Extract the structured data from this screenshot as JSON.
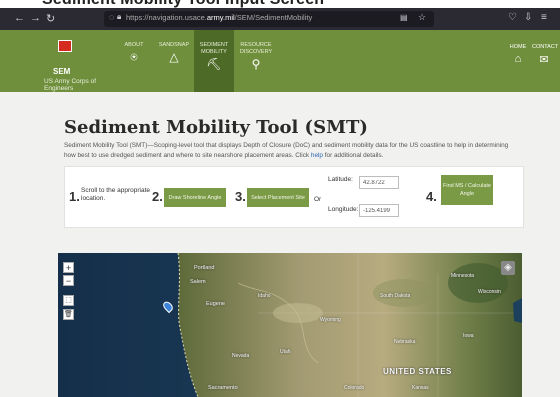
{
  "caption": "Sediment Mobility Tool Input Screen",
  "browser": {
    "url_prefix": "https://navigation.usace.",
    "url_domain": "army.mil",
    "url_path": "/SEM/SedimentMobility"
  },
  "logo": {
    "abbr": "SEM",
    "subtitle": "US Army Corps of Engineers"
  },
  "menu": [
    {
      "label": "ABOUT",
      "icon": "lightbulb-icon"
    },
    {
      "label": "SANDSNAP",
      "icon": "triangle-icon"
    },
    {
      "label": "SEDIMENT MOBILITY",
      "icon": "crane-icon",
      "active": true
    },
    {
      "label": "RESOURCE DISCOVERY",
      "icon": "search-icon"
    }
  ],
  "menu_right": [
    {
      "label": "HOME",
      "icon": "home-icon"
    },
    {
      "label": "CONTACT",
      "icon": "mail-icon"
    }
  ],
  "page": {
    "title": "Sediment Mobility Tool (SMT)",
    "description_pre": "Sediment Mobility Tool (SMT)—Scoping-level tool that displays Depth of Closure (DoC) and sediment mobility data for the US coastline to help in determining how best to use dredged sediment and where to site nearshore placement areas. Click ",
    "description_link": "help",
    "description_post": " for additional details."
  },
  "steps": {
    "step1_num": "1.",
    "step1_text": "Scroll to the appropriate location.",
    "step2_num": "2.",
    "step2_button": "Draw Shoreline Angle",
    "step3_num": "3.",
    "step3_button": "Select Placement Site",
    "or_text": "Or",
    "latitude_label": "Latitude:",
    "latitude_value": "42.8722",
    "longitude_label": "Longitude:",
    "longitude_value": "-125.4199",
    "step4_num": "4.",
    "step4_button": "Find MS / Calculate Angle"
  },
  "map": {
    "zoom_in": "+",
    "zoom_out": "−",
    "labels": [
      "Portland",
      "Salem",
      "Eugene",
      "Idaho",
      "Wyoming",
      "South Dakota",
      "Nebraska",
      "Minnesota",
      "Wisconsin",
      "Iowa",
      "Nevada",
      "Utah",
      "Colorado",
      "Kansas",
      "UNITED STATES",
      "Sacramento"
    ]
  },
  "colors": {
    "header_green": "#6f8f3c",
    "active_menu": "#4d6a26",
    "button_green": "#7a9a46",
    "link_blue": "#2c67b2"
  }
}
